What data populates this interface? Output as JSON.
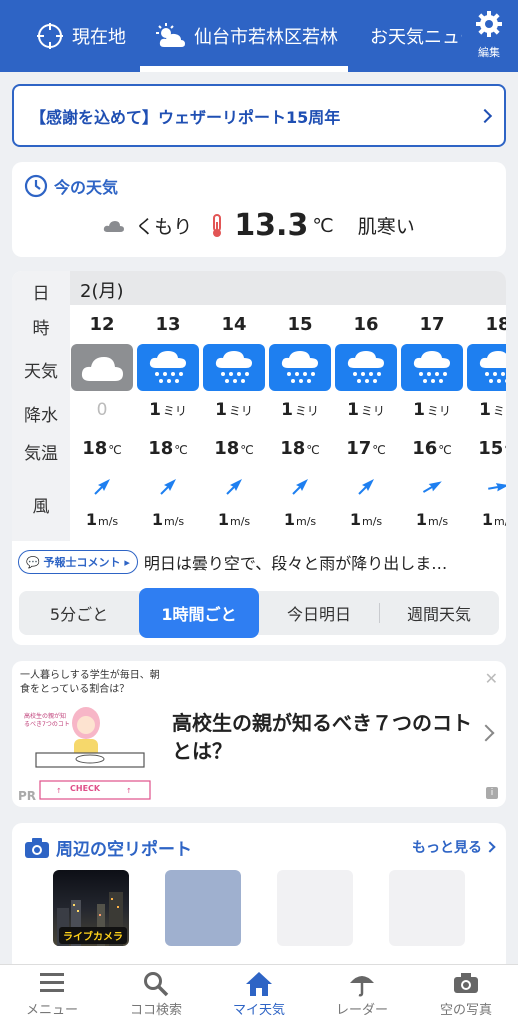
{
  "topbar": {
    "current_location": "現在地",
    "city": "仙台市若林区若林",
    "news": "お天気ニュース",
    "edit": "編集"
  },
  "banner": {
    "text": "【感謝を込めて】ウェザーリポート15周年"
  },
  "current_weather": {
    "heading": "今の天気",
    "condition": "くもり",
    "temperature": "13.3",
    "unit": "℃",
    "feel": "肌寒い"
  },
  "hourly": {
    "labels": {
      "day": "日",
      "hour": "時",
      "weather": "天気",
      "precip": "降水",
      "temp": "気温",
      "wind": "風"
    },
    "day": "2(月)",
    "precip_unit": "ミリ",
    "temp_unit": "℃",
    "wind_unit": "m/s",
    "hours": [
      {
        "hour": "12",
        "weather": "cloudy",
        "precip": "0",
        "temp": "18",
        "wind": "1",
        "wind_dir_deg": 45
      },
      {
        "hour": "13",
        "weather": "rain",
        "precip": "1",
        "temp": "18",
        "wind": "1",
        "wind_dir_deg": 45
      },
      {
        "hour": "14",
        "weather": "rain",
        "precip": "1",
        "temp": "18",
        "wind": "1",
        "wind_dir_deg": 45
      },
      {
        "hour": "15",
        "weather": "rain",
        "precip": "1",
        "temp": "18",
        "wind": "1",
        "wind_dir_deg": 45
      },
      {
        "hour": "16",
        "weather": "rain",
        "precip": "1",
        "temp": "17",
        "wind": "1",
        "wind_dir_deg": 45
      },
      {
        "hour": "17",
        "weather": "rain",
        "precip": "1",
        "temp": "16",
        "wind": "1",
        "wind_dir_deg": 60
      },
      {
        "hour": "18",
        "weather": "rain",
        "precip": "1",
        "temp": "15",
        "wind": "1",
        "wind_dir_deg": 80
      }
    ],
    "comment_label": "予報士コメント",
    "comment": "明日は曇り空で、段々と雨が降り出しま…",
    "tabs": [
      "5分ごと",
      "1時間ごと",
      "今日明日",
      "週間天気"
    ],
    "active_tab": 1
  },
  "ad": {
    "question": "一人暮らしする学生が毎日、朝食をとっている割合は？",
    "illus_text": "高校生の親が知るべき7つのコト",
    "check_label": "CHECK",
    "title": "高校生の親が知るべき７つのコトとは？",
    "pr": "PR"
  },
  "sky_report": {
    "heading": "周辺の空リポート",
    "more": "もっと見る",
    "live_badge": "ライブカメラ"
  },
  "bottomnav": {
    "items": [
      "メニュー",
      "ココ検索",
      "マイ天気",
      "レーダー",
      "空の写真"
    ],
    "active": 2
  },
  "colors": {
    "brand": "#2e64c5",
    "active_tab": "#2f7ef2",
    "rain_tile": "#1e7ff0",
    "cloudy_tile": "#8d8f92"
  }
}
